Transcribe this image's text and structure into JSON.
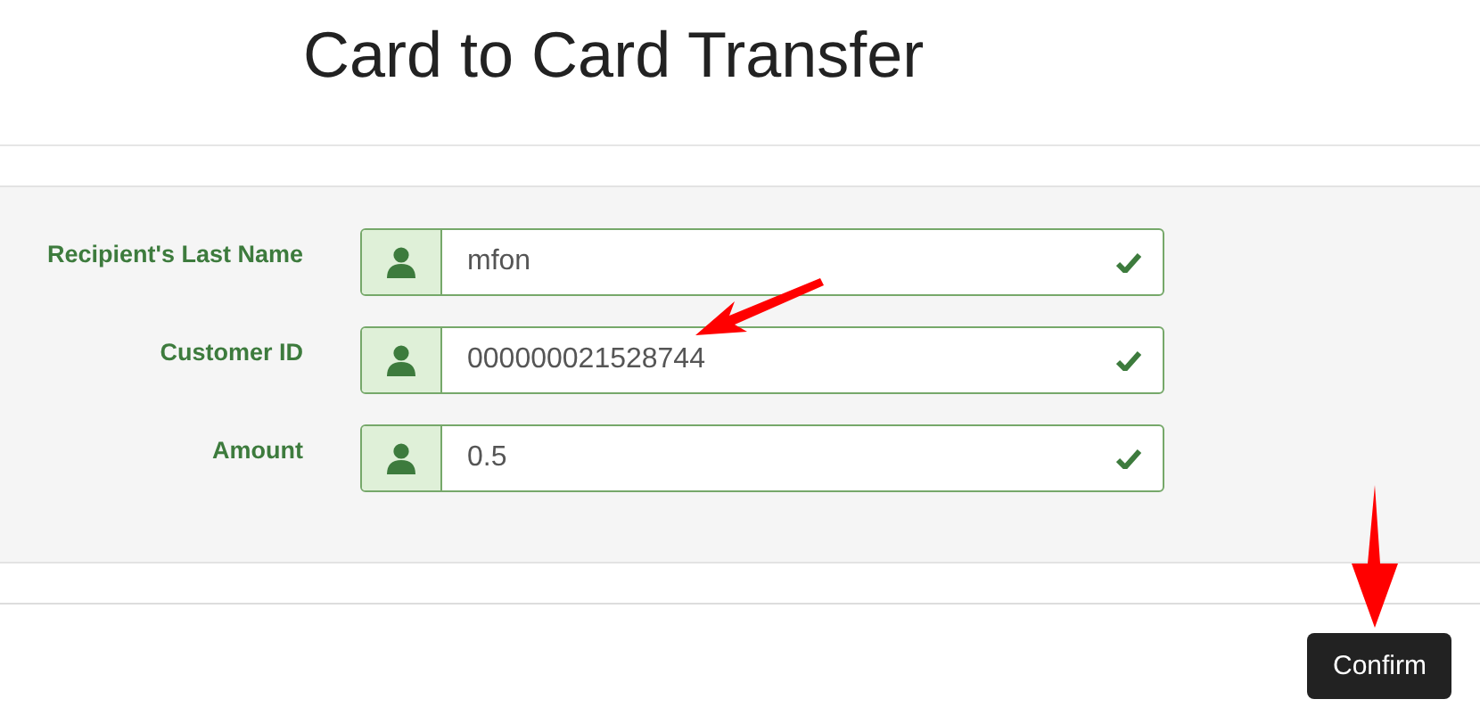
{
  "title": "Card to Card Transfer",
  "fields": [
    {
      "label": "Recipient's Last Name",
      "value": "mfon",
      "valid": true
    },
    {
      "label": "Customer ID",
      "value": "000000021528744",
      "valid": true
    },
    {
      "label": "Amount",
      "value": "0.5",
      "valid": true
    }
  ],
  "buttons": [
    "Confirm"
  ]
}
